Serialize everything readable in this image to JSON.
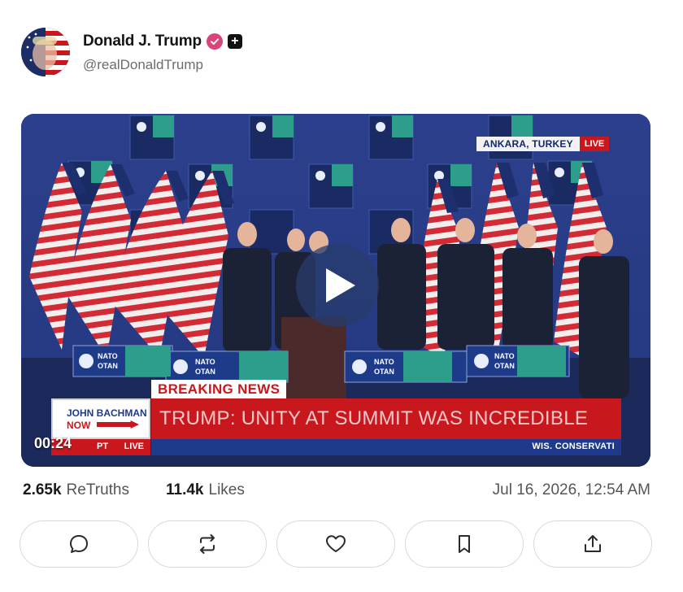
{
  "author": {
    "display_name": "Donald J. Trump",
    "handle": "@realDonaldTrump",
    "verified_badge_color": "#d9457a"
  },
  "video": {
    "location_banner": "ANKARA, TURKEY",
    "location_live": "LIVE",
    "breaking_label": "BREAKING NEWS",
    "headline": "TRUMP: UNITY AT SUMMIT WAS INCREDIBLE",
    "ticker_text": "WIS. CONSERVATI",
    "show_line1": "JOHN BACHMAN",
    "show_line2": "NOW",
    "strip_time": "PT",
    "strip_live": "LIVE",
    "timecode": "00:24",
    "podium_signs": [
      "NATO",
      "OTAN"
    ],
    "accent_red": "#c8181e",
    "accent_blue": "#1f3a8c"
  },
  "stats": {
    "retruths_count": "2.65k",
    "retruths_label": "ReTruths",
    "likes_count": "11.4k",
    "likes_label": "Likes",
    "timestamp": "Jul 16, 2026, 12:54 AM"
  },
  "actions": [
    {
      "icon": "reply-icon"
    },
    {
      "icon": "retruth-icon"
    },
    {
      "icon": "like-icon"
    },
    {
      "icon": "bookmark-icon"
    },
    {
      "icon": "share-icon"
    }
  ]
}
